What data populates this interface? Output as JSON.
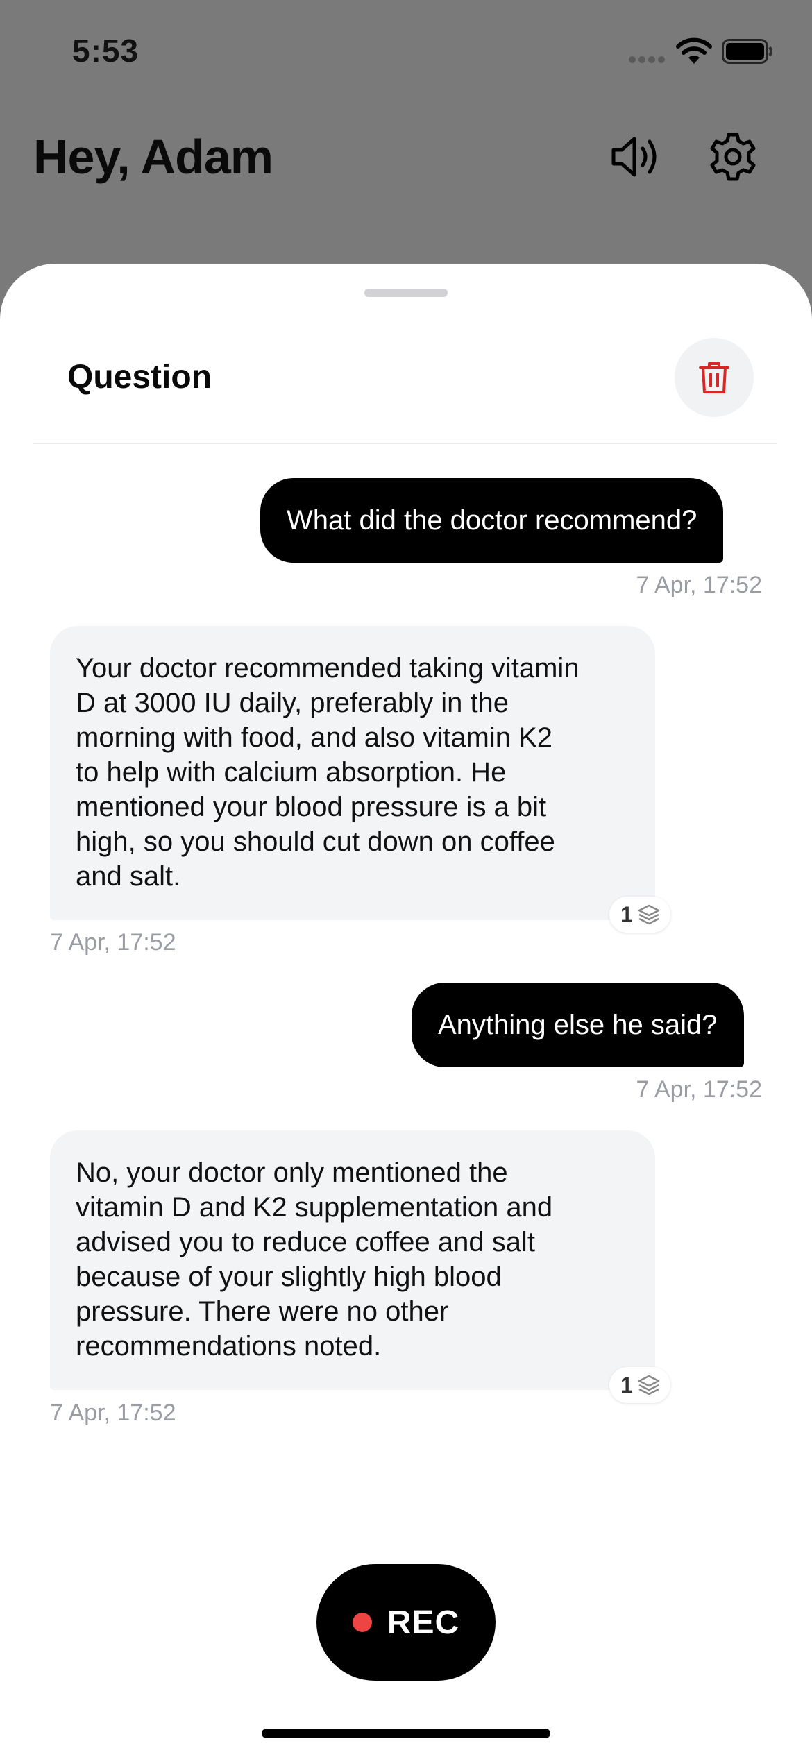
{
  "status_bar": {
    "time": "5:53"
  },
  "header": {
    "title": "Hey, Adam"
  },
  "sheet": {
    "title": "Question"
  },
  "messages": [
    {
      "role": "user",
      "text": "What did the doctor recommend?",
      "timestamp": "7 Apr, 17:52"
    },
    {
      "role": "assistant",
      "lines": [
        "Your doctor recommended taking vitamin",
        "D at 3000 IU daily, preferably in the",
        "morning with food, and also vitamin K2",
        "to help with calcium absorption. He",
        "mentioned your blood pressure is a bit",
        "high, so you should cut down on coffee",
        "and salt."
      ],
      "sources_count": "1",
      "timestamp": "7 Apr, 17:52"
    },
    {
      "role": "user",
      "text": "Anything else he said?",
      "timestamp": "7 Apr, 17:52"
    },
    {
      "role": "assistant",
      "lines": [
        "No, your doctor only mentioned the",
        "vitamin D and K2 supplementation and",
        "advised you to reduce coffee and salt",
        "because of your slightly high blood",
        "pressure. There were no other",
        "recommendations noted."
      ],
      "sources_count": "1",
      "timestamp": "7 Apr, 17:52"
    }
  ],
  "record": {
    "label": "REC"
  },
  "colors": {
    "backdrop": "#7a7a7a",
    "user_bubble": "#000000",
    "assistant_bubble": "#f3f4f6",
    "delete_accent": "#dc2626",
    "rec_dot": "#ef4444",
    "timestamp": "#9a9ca3"
  },
  "icons": {
    "status": [
      "signal-icon",
      "wifi-icon",
      "battery-icon"
    ],
    "header": [
      "speaker-icon",
      "gear-icon"
    ],
    "sheet": [
      "trash-icon"
    ],
    "badge": "layers-icon"
  }
}
